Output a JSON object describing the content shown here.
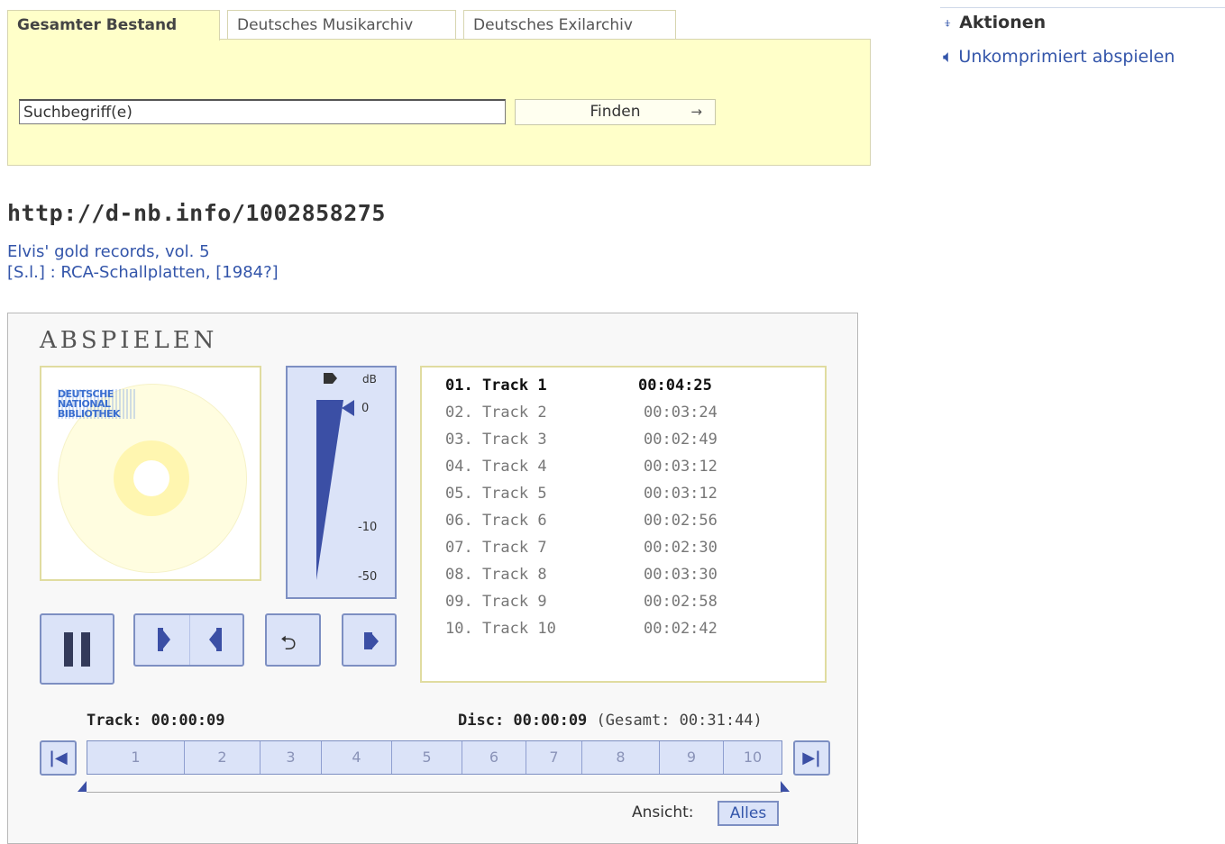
{
  "tabs": [
    {
      "label": "Gesamter Bestand",
      "active": true
    },
    {
      "label": "Deutsches Musikarchiv",
      "active": false
    },
    {
      "label": "Deutsches Exilarchiv",
      "active": false
    }
  ],
  "search": {
    "value": "Suchbegriff(e)",
    "button_label": "Finden",
    "button_arrow": "→"
  },
  "actions": {
    "icon": "upload-icon",
    "title": "Aktionen",
    "link_icon": "speaker-icon",
    "link_label": "Unkomprimiert abspielen"
  },
  "record": {
    "url": "http://d-nb.info/1002858275",
    "title": "Elvis' gold records, vol. 5",
    "publisher": "[S.l.] : RCA-Schallplatten, [1984?]"
  },
  "player": {
    "heading": "ABSPIELEN",
    "cover_logo": [
      "DEUTSCHE",
      "NATIONAL",
      "BIBLIOTHEK"
    ],
    "volume": {
      "unit": "dB",
      "levels": [
        "0",
        "-10",
        "-50"
      ],
      "current": "0"
    },
    "tracks": [
      {
        "name": "01. Track 1",
        "duration": "00:04:25",
        "active": true
      },
      {
        "name": "02. Track 2",
        "duration": "00:03:24",
        "active": false
      },
      {
        "name": "03. Track 3",
        "duration": "00:02:49",
        "active": false
      },
      {
        "name": "04. Track 4",
        "duration": "00:03:12",
        "active": false
      },
      {
        "name": "05. Track 5",
        "duration": "00:03:12",
        "active": false
      },
      {
        "name": "06. Track 6",
        "duration": "00:02:56",
        "active": false
      },
      {
        "name": "07. Track 7",
        "duration": "00:02:30",
        "active": false
      },
      {
        "name": "08. Track 8",
        "duration": "00:03:30",
        "active": false
      },
      {
        "name": "09. Track 9",
        "duration": "00:02:58",
        "active": false
      },
      {
        "name": "10. Track 10",
        "duration": "00:02:42",
        "active": false
      }
    ],
    "track_time_label": "Track: 00:00:09",
    "disc_time_label": "Disc: 00:00:09",
    "total_label": "(Gesamt: 00:31:44)",
    "segments": [
      "1",
      "2",
      "3",
      "4",
      "5",
      "6",
      "7",
      "8",
      "9",
      "10"
    ],
    "view_label": "Ansicht:",
    "view_button": "Alles"
  },
  "colors": {
    "search_bg": "#ffffc9",
    "accent": "#3b4fa5",
    "link": "#3355aa",
    "button_bg": "#dbe3f8"
  }
}
